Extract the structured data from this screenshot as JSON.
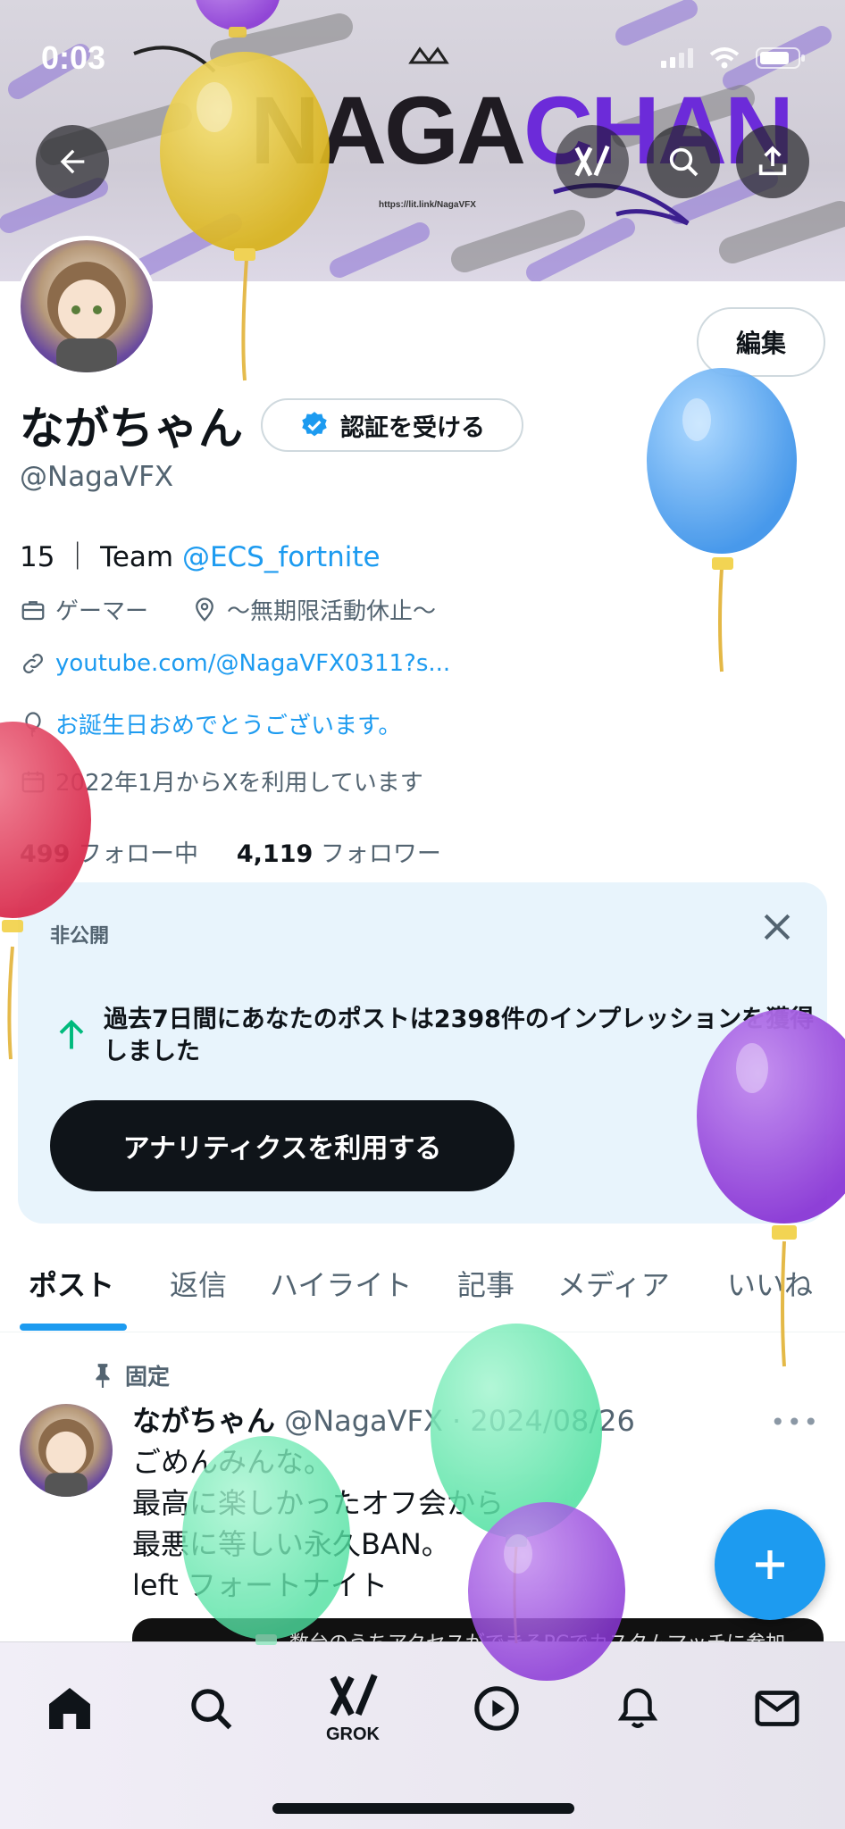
{
  "status_bar": {
    "time": "0:03"
  },
  "banner": {
    "logo_part1": "NAGA",
    "logo_part2": "CHAN",
    "url": "https://lit.link/NagaVFX"
  },
  "header_buttons": {
    "back": "back-arrow-icon",
    "search": "search-icon",
    "share": "share-icon"
  },
  "profile": {
    "edit_label": "編集",
    "display_name": "ながちゃん",
    "verify_label": "認証を受ける",
    "handle": "@NagaVFX",
    "bio_prefix": "15 ｜ Team ",
    "bio_link": "@ECS_fortnite",
    "category": "ゲーマー",
    "location": "〜無期限活動休止〜",
    "website": "youtube.com/@NagaVFX0311?s...",
    "birthday": "お誕生日おめでとうございます。",
    "joined": "2022年1月からXを利用しています",
    "following_count": "499",
    "following_label": "フォロー中",
    "followers_count": "4,119",
    "followers_label": "フォロワー"
  },
  "analytics_card": {
    "label": "非公開",
    "text": "過去7日間にあなたのポストは2398件のインプレッションを獲得しました",
    "button": "アナリティクスを利用する"
  },
  "tabs": [
    {
      "label": "ポスト",
      "active": true
    },
    {
      "label": "返信",
      "active": false
    },
    {
      "label": "ハイライト",
      "active": false
    },
    {
      "label": "記事",
      "active": false
    },
    {
      "label": "メディア",
      "active": false
    },
    {
      "label": "いいね",
      "active": false
    }
  ],
  "pinned_post": {
    "pinned_label": "固定",
    "author": "ながちゃん",
    "meta": "@NagaVFX · 2024/08/26",
    "lines": [
      "ごめんみんな。",
      "最高に楽しかったオフ会から",
      "最悪に等しい永久BAN。",
      "left フォートナイト"
    ],
    "media_caption": "数台のうちアクセスができるPCでカスタムマッチに参加"
  },
  "bottom_nav": {
    "items": [
      "home-icon",
      "search-icon",
      "grok-icon",
      "video-icon",
      "notifications-icon",
      "messages-icon"
    ],
    "grok_label": "GROK"
  },
  "colors": {
    "accent": "#1d9bf0",
    "text": "#0f1419",
    "muted": "#536471",
    "card_bg": "#e8f4fc",
    "logo_purple": "#6c2bd9"
  }
}
